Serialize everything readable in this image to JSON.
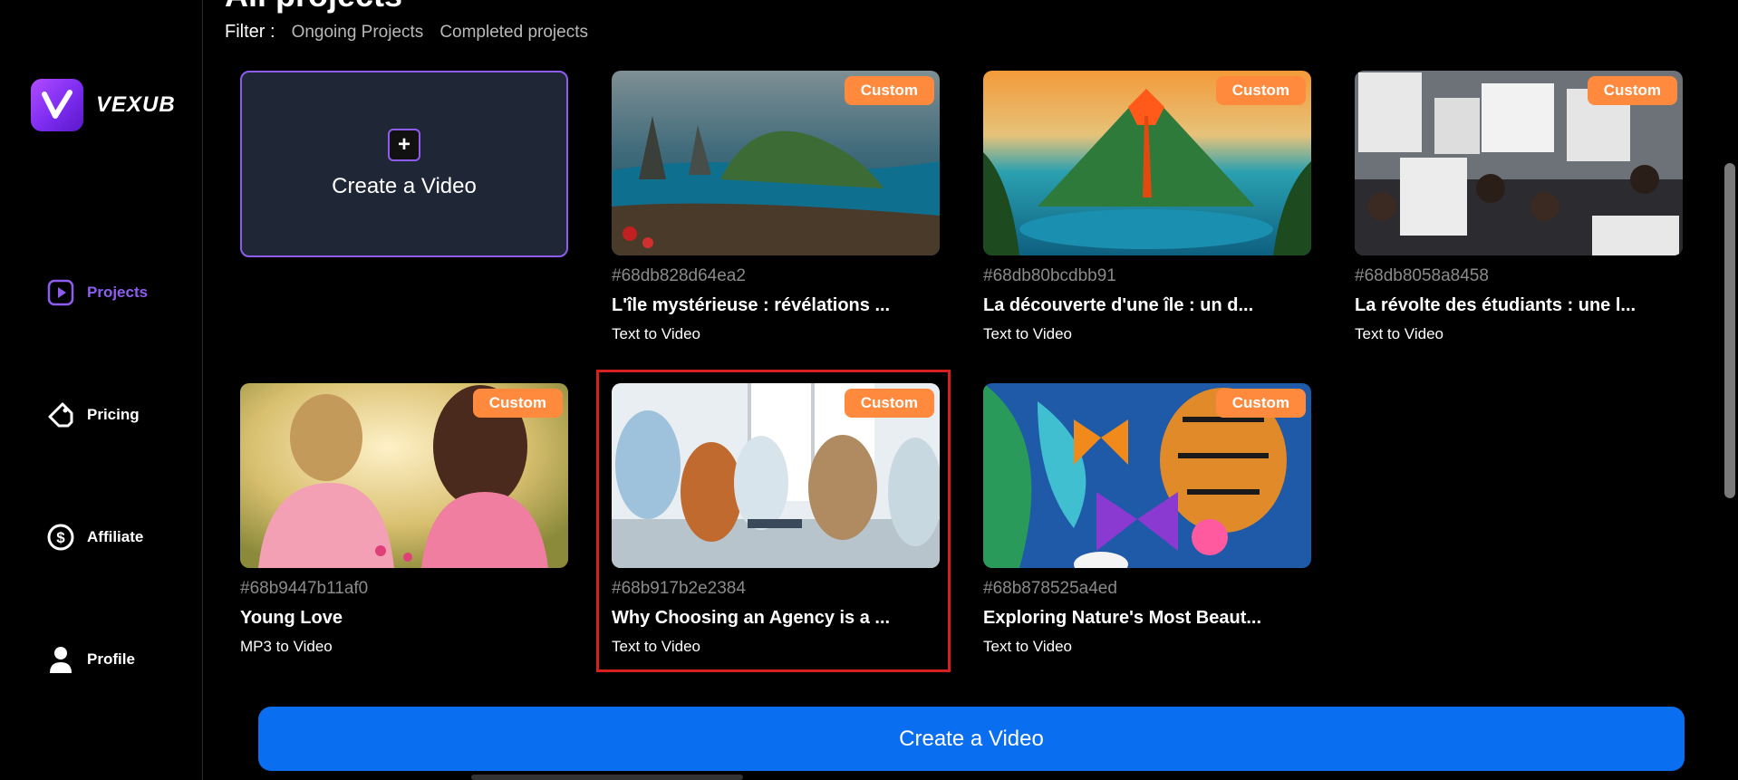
{
  "app": {
    "brand": "VEXUB"
  },
  "page": {
    "title": "All projects"
  },
  "filter": {
    "label": "Filter :",
    "options": [
      "Ongoing Projects",
      "Completed projects"
    ]
  },
  "sidebar": {
    "items": [
      {
        "label": "Projects",
        "icon": "play-square-icon",
        "active": true
      },
      {
        "label": "Pricing",
        "icon": "tag-icon",
        "active": false
      },
      {
        "label": "Affiliate",
        "icon": "dollar-circle-icon",
        "active": false
      },
      {
        "label": "Profile",
        "icon": "user-icon",
        "active": false
      }
    ]
  },
  "create_card": {
    "plus": "+",
    "label": "Create a Video"
  },
  "projects": [
    {
      "id": "#68db828d64ea2",
      "title": "L'île mystérieuse : révélations ...",
      "type": "Text to Video",
      "badge": "Custom"
    },
    {
      "id": "#68db80bcdbb91",
      "title": "La découverte d'une île : un d...",
      "type": "Text to Video",
      "badge": "Custom"
    },
    {
      "id": "#68db8058a8458",
      "title": "La révolte des étudiants : une l...",
      "type": "Text to Video",
      "badge": "Custom"
    },
    {
      "id": "#68b9447b11af0",
      "title": "Young Love",
      "type": "MP3 to Video",
      "badge": "Custom"
    },
    {
      "id": "#68b917b2e2384",
      "title": "Why Choosing an Agency is a ...",
      "type": "Text to Video",
      "badge": "Custom",
      "highlighted": true
    },
    {
      "id": "#68b878525a4ed",
      "title": "Exploring Nature's Most Beaut...",
      "type": "Text to Video",
      "badge": "Custom"
    }
  ],
  "bottom_button": {
    "label": "Create a Video"
  },
  "colors": {
    "accent": "#8e5df0",
    "badge": "#ff8a3d",
    "primary_button": "#0a6ef0",
    "highlight": "#d62020"
  }
}
